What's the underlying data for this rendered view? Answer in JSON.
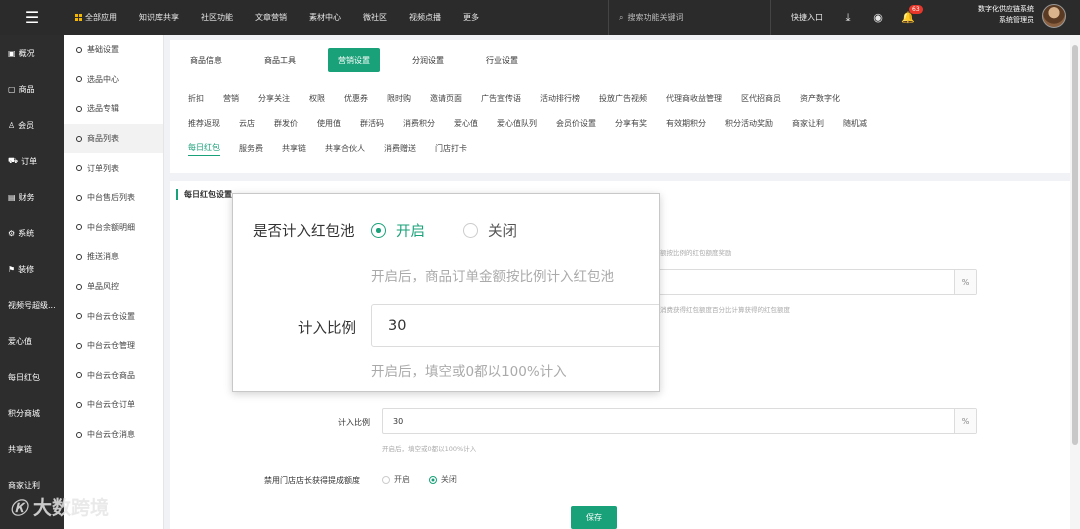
{
  "topbar": {
    "menu_items": [
      "全部应用",
      "知识库共享",
      "社区功能",
      "文章营销",
      "素材中心",
      "微社区",
      "视频点播",
      "更多"
    ],
    "search_placeholder": "搜索功能关键词",
    "quick_entry": "快捷入口",
    "notification_count": "63",
    "user_line1": "数字化供应链系统",
    "user_line2": "系统管理员"
  },
  "leftnav": {
    "items": [
      "概况",
      "商品",
      "会员",
      "订单",
      "财务",
      "系统",
      "装修",
      "视频号超级...",
      "爱心值",
      "每日红包",
      "积分商城",
      "共享链",
      "商家让利"
    ]
  },
  "subnav": {
    "items": [
      "基础设置",
      "选品中心",
      "选品专辑",
      "商品列表",
      "订单列表",
      "中台售后列表",
      "中台余额明细",
      "推送消息",
      "单品风控",
      "中台云仓设置",
      "中台云仓管理",
      "中台云仓商品",
      "中台云仓订单",
      "中台云仓消息"
    ],
    "active_index": 3
  },
  "main": {
    "tabs": [
      "商品信息",
      "商品工具",
      "营销设置",
      "分润设置",
      "行业设置"
    ],
    "active_tab": 2,
    "subtabs_row1": [
      "折扣",
      "营销",
      "分享关注",
      "权限",
      "优惠券",
      "限时购",
      "邀请页面",
      "广告宣传语",
      "活动排行榜",
      "投放广告视频",
      "代理商收益管理",
      "区代招商员",
      "资产数字化"
    ],
    "subtabs_row2": [
      "推荐返现",
      "云店",
      "群发价",
      "使用值",
      "群活码",
      "消费积分",
      "爱心值",
      "爱心值队列",
      "会员价设置",
      "分享有奖",
      "有效期积分",
      "积分活动奖励",
      "商家让利",
      "随机减"
    ],
    "subtabs_row3": [
      "每日红包",
      "服务费",
      "共享链",
      "共享合伙人",
      "消费赠送",
      "门店打卡"
    ],
    "section_title": "每日红包设置",
    "bg_hint1": "额按比例的红包额度奖励",
    "bg_suffix": "%",
    "bg_hint2": "消费获得红包额度百分比计算获得的红包额度",
    "ratio_label": "计入比例",
    "ratio_value": "30",
    "ratio_hint": "开启后，填空或0都以100%计入",
    "store_label": "禁用门店店长获得提成额度",
    "store_on": "开启",
    "store_off": "关闭",
    "save_label": "保存"
  },
  "popup": {
    "label1": "是否计入红包池",
    "opt_on": "开启",
    "opt_off": "关闭",
    "hint1": "开启后，商品订单金额按比例计入红包池",
    "label2": "计入比例",
    "value": "30",
    "hint2": "开启后，填空或0都以100%计入"
  },
  "watermark": {
    "text": "大数跨境"
  }
}
